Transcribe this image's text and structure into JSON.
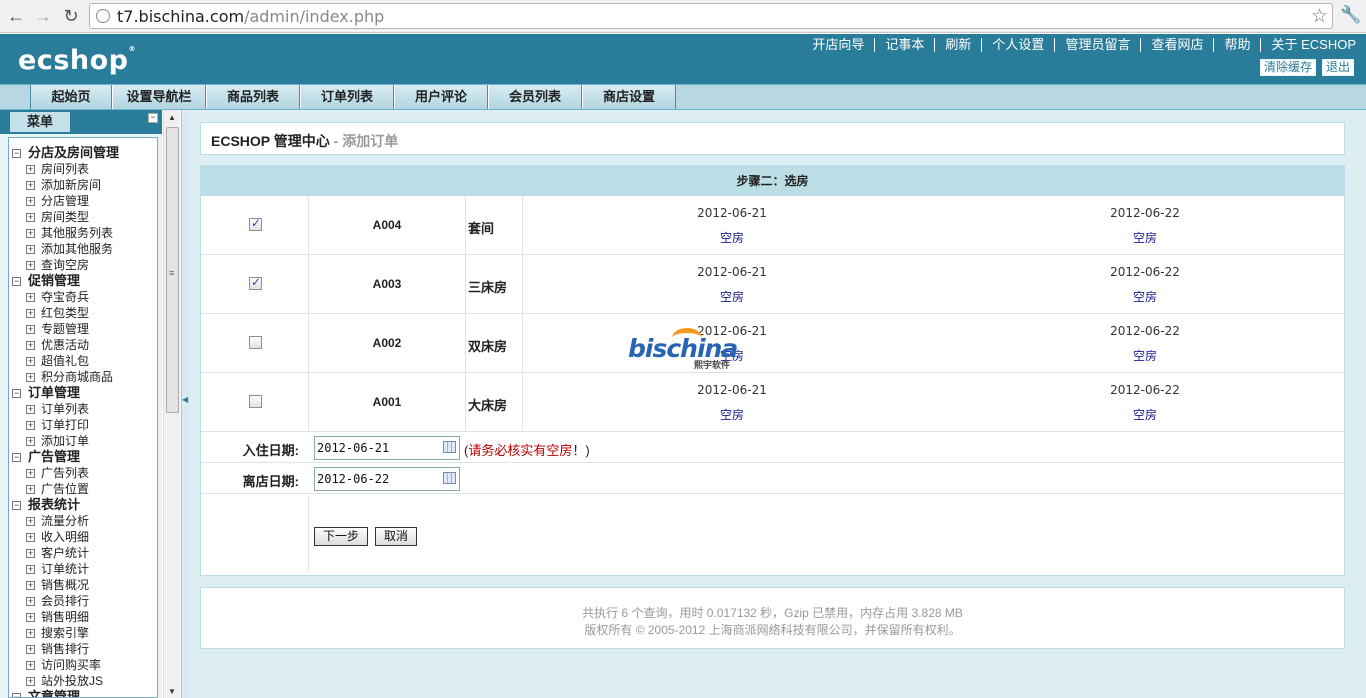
{
  "browser": {
    "url_host": "t7.bischina.com",
    "url_path": "/admin/index.php"
  },
  "header": {
    "logo": "ECSHOP",
    "links": [
      "开店向导",
      "记事本",
      "刷新",
      "个人设置",
      "管理员留言",
      "查看网店",
      "帮助",
      "关于 ECSHOP"
    ],
    "buttons": {
      "clear_cache": "清除缓存",
      "logout": "退出"
    }
  },
  "menu": {
    "tabs": [
      "起始页",
      "设置导航栏",
      "商品列表",
      "订单列表",
      "用户评论",
      "会员列表",
      "商店设置"
    ]
  },
  "sidebar": {
    "title": "菜单",
    "groups": [
      {
        "label": "分店及房间管理",
        "items": [
          "房间列表",
          "添加新房间",
          "分店管理",
          "房间类型",
          "其他服务列表",
          "添加其他服务",
          "查询空房"
        ]
      },
      {
        "label": "促销管理",
        "items": [
          "夺宝奇兵",
          "红包类型",
          "专题管理",
          "优惠活动",
          "超值礼包",
          "积分商城商品"
        ]
      },
      {
        "label": "订单管理",
        "items": [
          "订单列表",
          "订单打印",
          "添加订单"
        ]
      },
      {
        "label": "广告管理",
        "items": [
          "广告列表",
          "广告位置"
        ]
      },
      {
        "label": "报表统计",
        "items": [
          "流量分析",
          "收入明细",
          "客户统计",
          "订单统计",
          "销售概况",
          "会员排行",
          "销售明细",
          "搜索引擎",
          "销售排行",
          "访问购买率",
          "站外投放JS"
        ]
      },
      {
        "label": "文章管理",
        "items": []
      }
    ]
  },
  "page": {
    "title": "ECSHOP 管理中心",
    "subtitle": " - 添加订单",
    "step": "步骤二：选房",
    "rooms": [
      {
        "no": "A004",
        "type": "套间",
        "checked": true,
        "days": [
          {
            "date": "2012-06-21",
            "status": "空房"
          },
          {
            "date": "2012-06-22",
            "status": "空房"
          }
        ]
      },
      {
        "no": "A003",
        "type": "三床房",
        "checked": true,
        "days": [
          {
            "date": "2012-06-21",
            "status": "空房"
          },
          {
            "date": "2012-06-22",
            "status": "空房"
          }
        ]
      },
      {
        "no": "A002",
        "type": "双床房",
        "checked": false,
        "days": [
          {
            "date": "2012-06-21",
            "status": "空房"
          },
          {
            "date": "2012-06-22",
            "status": "空房"
          }
        ]
      },
      {
        "no": "A001",
        "type": "大床房",
        "checked": false,
        "days": [
          {
            "date": "2012-06-21",
            "status": "空房"
          },
          {
            "date": "2012-06-22",
            "status": "空房"
          }
        ]
      }
    ],
    "checkin_label": "入住日期:",
    "checkin_value": "2012-06-21",
    "checkin_note_open": "(",
    "checkin_note_warn": "请务必核实有空房",
    "checkin_note_close": "！)",
    "checkout_label": "离店日期:",
    "checkout_value": "2012-06-22",
    "next_button": "下一步",
    "cancel_button": "取消"
  },
  "footer": {
    "line1": "共执行 6 个查询，用时 0.017132 秒，Gzip 已禁用，内存占用 3.828 MB",
    "line2": "版权所有 © 2005-2012 上海商派网络科技有限公司，并保留所有权利。"
  },
  "watermark": {
    "text": "bischina",
    "sub": "熙宇软件"
  },
  "colors": {
    "header_bg": "#2a7d9a",
    "status_link": "#1a1a8f",
    "warn": "#b00000"
  }
}
